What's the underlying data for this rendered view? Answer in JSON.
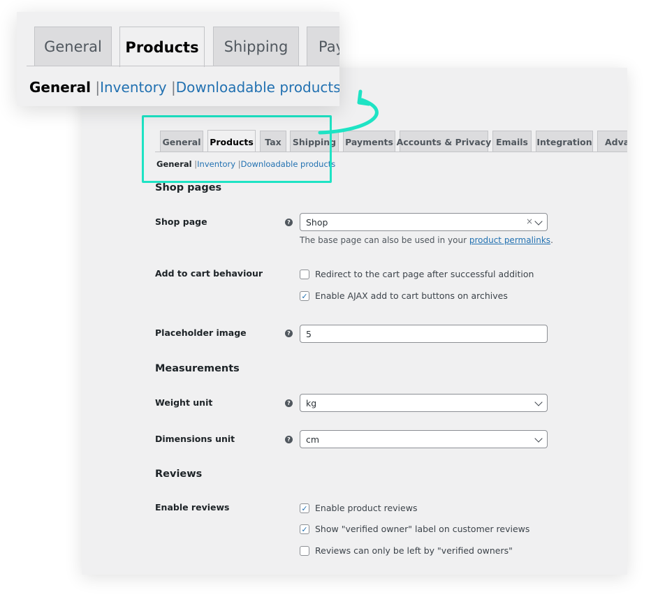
{
  "tabs": [
    "General",
    "Products",
    "Tax",
    "Shipping",
    "Payments",
    "Accounts & Privacy",
    "Emails",
    "Integration",
    "Advanced"
  ],
  "active_tab": "Products",
  "subnav": {
    "current": "General",
    "links": [
      "Inventory",
      "Downloadable products"
    ],
    "separator": "|"
  },
  "callout": {
    "tabs": [
      "General",
      "Products",
      "Shipping",
      "Payments"
    ],
    "subnav_current": "General",
    "subnav_links": [
      "Inventory",
      "Downloadable products"
    ]
  },
  "sections": {
    "shop_pages": "Shop pages",
    "measurements": "Measurements",
    "reviews": "Reviews"
  },
  "fields": {
    "shop_page": {
      "label": "Shop page",
      "value": "Shop",
      "clear": "×",
      "desc_prefix": "The base page can also be used in your ",
      "desc_link": "product permalinks",
      "desc_suffix": "."
    },
    "add_to_cart": {
      "label": "Add to cart behaviour",
      "options": [
        {
          "label": "Redirect to the cart page after successful addition",
          "checked": false
        },
        {
          "label": "Enable AJAX add to cart buttons on archives",
          "checked": true
        }
      ]
    },
    "placeholder_image": {
      "label": "Placeholder image",
      "value": "5"
    },
    "weight_unit": {
      "label": "Weight unit",
      "value": "kg"
    },
    "dimensions_unit": {
      "label": "Dimensions unit",
      "value": "cm"
    },
    "enable_reviews": {
      "label": "Enable reviews",
      "options": [
        {
          "label": "Enable product reviews",
          "checked": true
        },
        {
          "label": "Show \"verified owner\" label on customer reviews",
          "checked": true
        },
        {
          "label": "Reviews can only be left by \"verified owners\"",
          "checked": false
        }
      ]
    }
  },
  "help_glyph": "?",
  "check_glyph": "✓",
  "colors": {
    "accent": "#2271b1",
    "highlight": "#1ee3c4",
    "background": "#f0f0f1"
  }
}
